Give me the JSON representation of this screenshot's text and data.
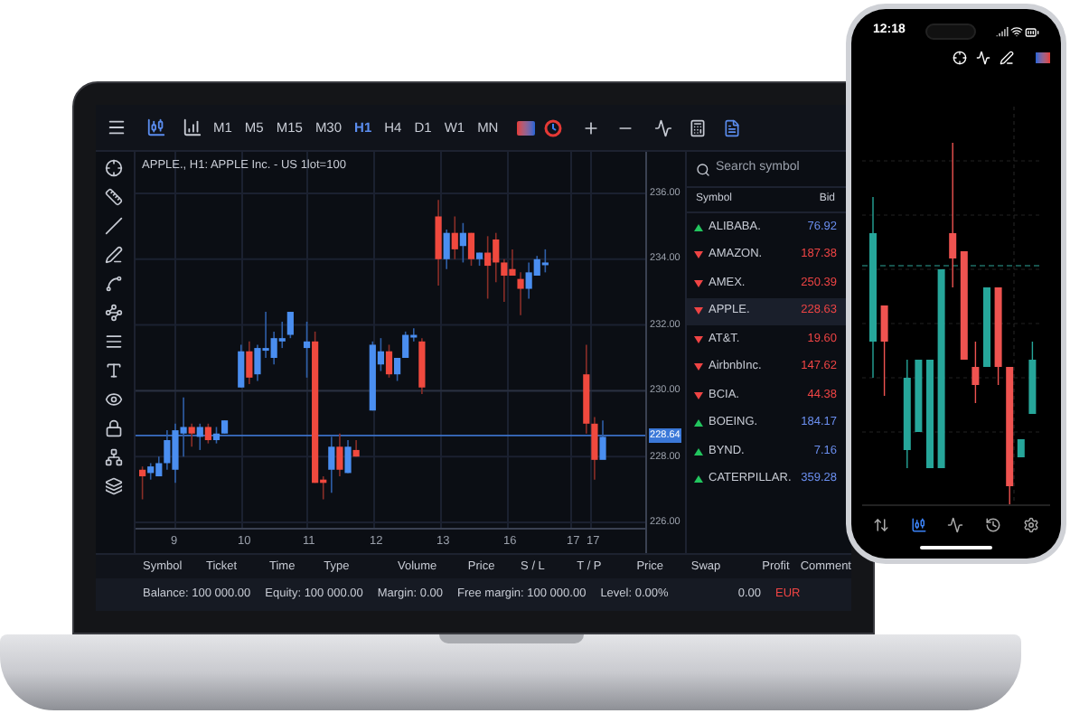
{
  "toolbar": {
    "timeframes": [
      {
        "label": "M1",
        "selected": false
      },
      {
        "label": "M5",
        "selected": false
      },
      {
        "label": "M15",
        "selected": false
      },
      {
        "label": "M30",
        "selected": false
      },
      {
        "label": "H1",
        "selected": true
      },
      {
        "label": "H4",
        "selected": false
      },
      {
        "label": "D1",
        "selected": false
      },
      {
        "label": "W1",
        "selected": false
      },
      {
        "label": "MN",
        "selected": false
      }
    ]
  },
  "chart": {
    "title": "APPLE., H1: APPLE Inc. - US 1lot=100",
    "price_ticks": [
      "236.00",
      "234.00",
      "232.00",
      "230.00",
      "228.00",
      "226.00"
    ],
    "current_price": "228.64",
    "time_labels": [
      "9",
      "10",
      "11",
      "12",
      "13",
      "16",
      "17",
      "17"
    ]
  },
  "symbols": {
    "search": {
      "placeholder": "Search symbol"
    },
    "columns": [
      "Symbol",
      "Bid"
    ],
    "rows": [
      {
        "kind": "up",
        "name": "ALIBABA.",
        "bid": "76.92",
        "selected": false
      },
      {
        "kind": "down",
        "name": "AMAZON.",
        "bid": "187.38",
        "selected": false
      },
      {
        "kind": "down",
        "name": "AMEX.",
        "bid": "250.39",
        "selected": false
      },
      {
        "kind": "down",
        "name": "APPLE.",
        "bid": "228.63",
        "selected": true
      },
      {
        "kind": "down",
        "name": "AT&T.",
        "bid": "19.60",
        "selected": false
      },
      {
        "kind": "down",
        "name": "AirbnbInc.",
        "bid": "147.62",
        "selected": false
      },
      {
        "kind": "down",
        "name": "BCIA.",
        "bid": "44.38",
        "selected": false
      },
      {
        "kind": "up",
        "name": "BOEING.",
        "bid": "184.17",
        "selected": false
      },
      {
        "kind": "up",
        "name": "BYND.",
        "bid": "7.16",
        "selected": false
      },
      {
        "kind": "up",
        "name": "CATERPILLAR.",
        "bid": "359.28",
        "selected": false
      }
    ]
  },
  "trades": {
    "columns": [
      "Symbol",
      "Ticket",
      "Time",
      "Type",
      "Volume",
      "Price",
      "S / L",
      "T / P",
      "Price",
      "Swap",
      "Profit",
      "Comment"
    ]
  },
  "account": {
    "items": [
      "Balance: 100 000.00",
      "Equity: 100 000.00",
      "Margin: 0.00",
      "Free margin: 100 000.00",
      "Level: 0.00%"
    ],
    "profit": "0.00",
    "currency": "EUR"
  },
  "phone": {
    "time": "12:18",
    "nav": [
      {
        "kind": "quotes",
        "selected": false
      },
      {
        "kind": "chart",
        "selected": true
      },
      {
        "kind": "trade",
        "selected": false
      },
      {
        "kind": "history",
        "selected": false
      },
      {
        "kind": "settings",
        "selected": false
      }
    ]
  }
}
